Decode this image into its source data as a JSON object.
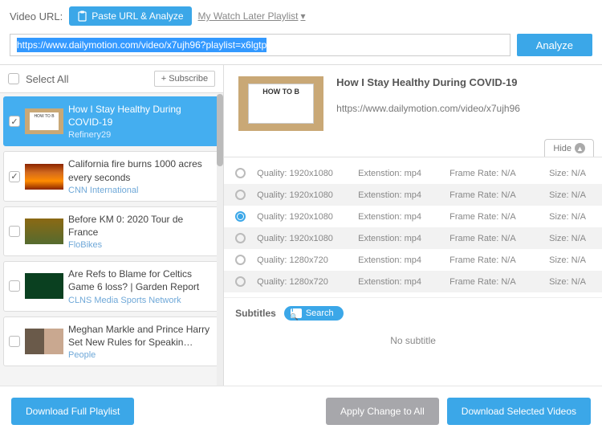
{
  "top": {
    "url_label": "Video URL:",
    "paste_label": "Paste URL & Analyze",
    "watch_later": "My Watch Later Playlist",
    "url_value": "https://www.dailymotion.com/video/x7ujh96?playlist=x6lgtp",
    "analyze_label": "Analyze"
  },
  "list_header": {
    "select_all": "Select All",
    "subscribe": "+ Subscribe"
  },
  "videos": [
    {
      "title": "How I Stay Healthy During COVID-19",
      "pub": "Refinery29",
      "checked": true,
      "selected": true,
      "thumb": "howto"
    },
    {
      "title": "California fire burns 1000 acres every seconds",
      "pub": "CNN International",
      "checked": true,
      "selected": false,
      "thumb": "fire"
    },
    {
      "title": "Before KM 0: 2020 Tour de France",
      "pub": "FloBikes",
      "checked": false,
      "selected": false,
      "thumb": "tour"
    },
    {
      "title": "Are Refs to Blame for Celtics Game 6 loss? | Garden Report",
      "pub": "CLNS Media Sports Network",
      "checked": false,
      "selected": false,
      "thumb": "refs"
    },
    {
      "title": "Meghan Markle and Prince Harry Set New Rules for Speakin…",
      "pub": "People",
      "checked": false,
      "selected": false,
      "thumb": "meghan"
    }
  ],
  "detail": {
    "title": "How I Stay Healthy During COVID-19",
    "url": "https://www.dailymotion.com/video/x7ujh96",
    "hide_label": "Hide",
    "thumb_text": "HOW TO B"
  },
  "quality_labels": {
    "q": "Quality:",
    "e": "Extenstion:",
    "f": "Frame Rate:",
    "s": "Size:"
  },
  "qualities": [
    {
      "res": "1920x1080",
      "ext": "mp4",
      "fr": "N/A",
      "size": "N/A",
      "selected": false
    },
    {
      "res": "1920x1080",
      "ext": "mp4",
      "fr": "N/A",
      "size": "N/A",
      "selected": false
    },
    {
      "res": "1920x1080",
      "ext": "mp4",
      "fr": "N/A",
      "size": "N/A",
      "selected": true
    },
    {
      "res": "1920x1080",
      "ext": "mp4",
      "fr": "N/A",
      "size": "N/A",
      "selected": false
    },
    {
      "res": "1280x720",
      "ext": "mp4",
      "fr": "N/A",
      "size": "N/A",
      "selected": false
    },
    {
      "res": "1280x720",
      "ext": "mp4",
      "fr": "N/A",
      "size": "N/A",
      "selected": false
    }
  ],
  "subtitles": {
    "label": "Subtitles",
    "search": "Search",
    "none": "No subtitle"
  },
  "bottom": {
    "full": "Download Full Playlist",
    "apply": "Apply Change to All",
    "selected": "Download Selected Videos"
  }
}
